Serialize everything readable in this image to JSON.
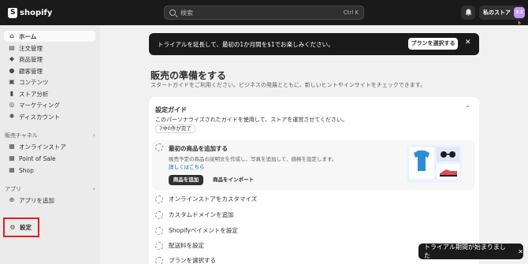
{
  "topbar": {
    "logo_text": "shopify",
    "search_placeholder": "検索",
    "search_shortcut": "Ctrl K",
    "store_name": "私のストア",
    "avatar_text": "ホスト"
  },
  "sidebar": {
    "items": [
      {
        "label": "ホーム",
        "icon": "home-icon",
        "glyph": "⌂"
      },
      {
        "label": "注文管理",
        "icon": "orders-icon",
        "glyph": "▤"
      },
      {
        "label": "商品管理",
        "icon": "tag-icon",
        "glyph": "◆"
      },
      {
        "label": "顧客管理",
        "icon": "person-icon",
        "glyph": "●"
      },
      {
        "label": "コンテンツ",
        "icon": "image-icon",
        "glyph": "▣"
      },
      {
        "label": "ストア分析",
        "icon": "chart-icon",
        "glyph": "▮"
      },
      {
        "label": "マーケティング",
        "icon": "target-icon",
        "glyph": "◎"
      },
      {
        "label": "ディスカウント",
        "icon": "discount-icon",
        "glyph": "✺"
      }
    ],
    "sales_channels_label": "販売チャネル",
    "channels": [
      {
        "label": "オンラインストア",
        "icon": "store-icon",
        "glyph": "▦"
      },
      {
        "label": "Point of Sale",
        "icon": "pos-icon",
        "glyph": "▦"
      },
      {
        "label": "Shop",
        "icon": "shop-icon",
        "glyph": "▦"
      }
    ],
    "apps_label": "アプリ",
    "add_app_label": "アプリを追加",
    "settings_label": "設定"
  },
  "banner": {
    "text": "トライアルを延長して、最初の1か月間を$1でお楽しみください。",
    "button_label": "プランを選択する",
    "close": "✕"
  },
  "main": {
    "title": "販売の準備をする",
    "subtitle": "スタートガイドをご利用ください。ビジネスの発展とともに、新しいヒントやインサイトをチェックできます。"
  },
  "guide": {
    "title": "設定ガイド",
    "description": "このパーソナライズされたガイドを使用して、ストアを運営させてください。",
    "progress_text": "7中0件が完了",
    "open_task": {
      "title": "最初の商品を追加する",
      "description": "販売予定の商品の説明文を作成し、写真を追加して、価格を設定します。",
      "link": "詳しくはこちら",
      "primary_button": "商品を追加",
      "secondary_button": "商品をインポート"
    },
    "tasks": [
      "オンラインストアをカスタマイズ",
      "カスタムドメインを追加",
      "Shopifyペイメントを設定",
      "配送料を設定",
      "プランを選択する"
    ]
  },
  "toast": {
    "text": "トライアル期間が始まりました",
    "close": "✕"
  },
  "colors": {
    "topbar": "#1a1a1a",
    "sidebar": "#ebebeb",
    "highlight": "#e51c23",
    "link": "#005bd3"
  }
}
